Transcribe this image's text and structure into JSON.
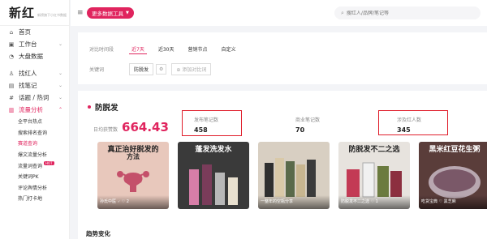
{
  "app": {
    "logo": "新红",
    "logo_sub": "新榜旗下小红书数据"
  },
  "sidebar": {
    "items": [
      {
        "label": "首页",
        "icon": "home-icon"
      },
      {
        "label": "工作台",
        "icon": "workbench-icon"
      },
      {
        "label": "大盘数据",
        "icon": "chart-icon"
      },
      {
        "label": "找红人",
        "icon": "user-icon"
      },
      {
        "label": "找笔记",
        "icon": "note-icon"
      },
      {
        "label": "话题 / 热词",
        "icon": "topic-icon"
      },
      {
        "label": "流量分析",
        "icon": "flow-icon"
      }
    ],
    "sub_items": [
      {
        "label": "全平台热点"
      },
      {
        "label": "搜索排名查询"
      },
      {
        "label": "赛道查询"
      },
      {
        "label": "爆文流量分析"
      },
      {
        "label": "流量词查询",
        "badge": "HOT"
      },
      {
        "label": "关键词PK"
      },
      {
        "label": "评论舆情分析"
      },
      {
        "label": "热门打卡地"
      }
    ]
  },
  "topbar": {
    "tools_label": "更多数据工具",
    "search_placeholder": "搜红人/品牌/笔记等"
  },
  "filter": {
    "time_label": "对比时间段",
    "time_options": [
      "近7天",
      "近30天",
      "营销节点",
      "自定义"
    ],
    "time_selected": "近7天",
    "keyword_label": "关键词",
    "keyword_value": "防脱发",
    "add_compare": "添加对比词"
  },
  "main": {
    "keyword_title": "防脱发",
    "likes_label": "日均获赞数",
    "likes_value": "664.43",
    "metrics": [
      {
        "label": "发布笔记数",
        "value": "458"
      },
      {
        "label": "商业笔记数",
        "value": "70"
      },
      {
        "label": "涉及红人数",
        "value": "345"
      }
    ],
    "thumbs": [
      {
        "title": "真正治好脱发的",
        "title2": "方法",
        "caption": "孙氏中医 🗸 ♡ 2",
        "bg": "#e8c8bc"
      },
      {
        "title": "蓬发洗发水",
        "title2": "",
        "caption": "",
        "bg": "#3a3a3a"
      },
      {
        "title": "",
        "title2": "",
        "caption": "一整年的空瓶分享",
        "bg": "#d8cfc2"
      },
      {
        "title": "防脱发不二之选",
        "title2": "",
        "caption": "防脱发不二之选 ♡ 1",
        "bg": "#e7e3de"
      },
      {
        "title": "黑米红豆花生粥",
        "title2": "",
        "caption": "吃货宝典 ♡ 黑芝麻",
        "bg": "#5a3d3a"
      }
    ],
    "trend_title": "趋势变化"
  },
  "colors": {
    "accent": "#e0245e",
    "highlight_box": "#e01e2b"
  }
}
